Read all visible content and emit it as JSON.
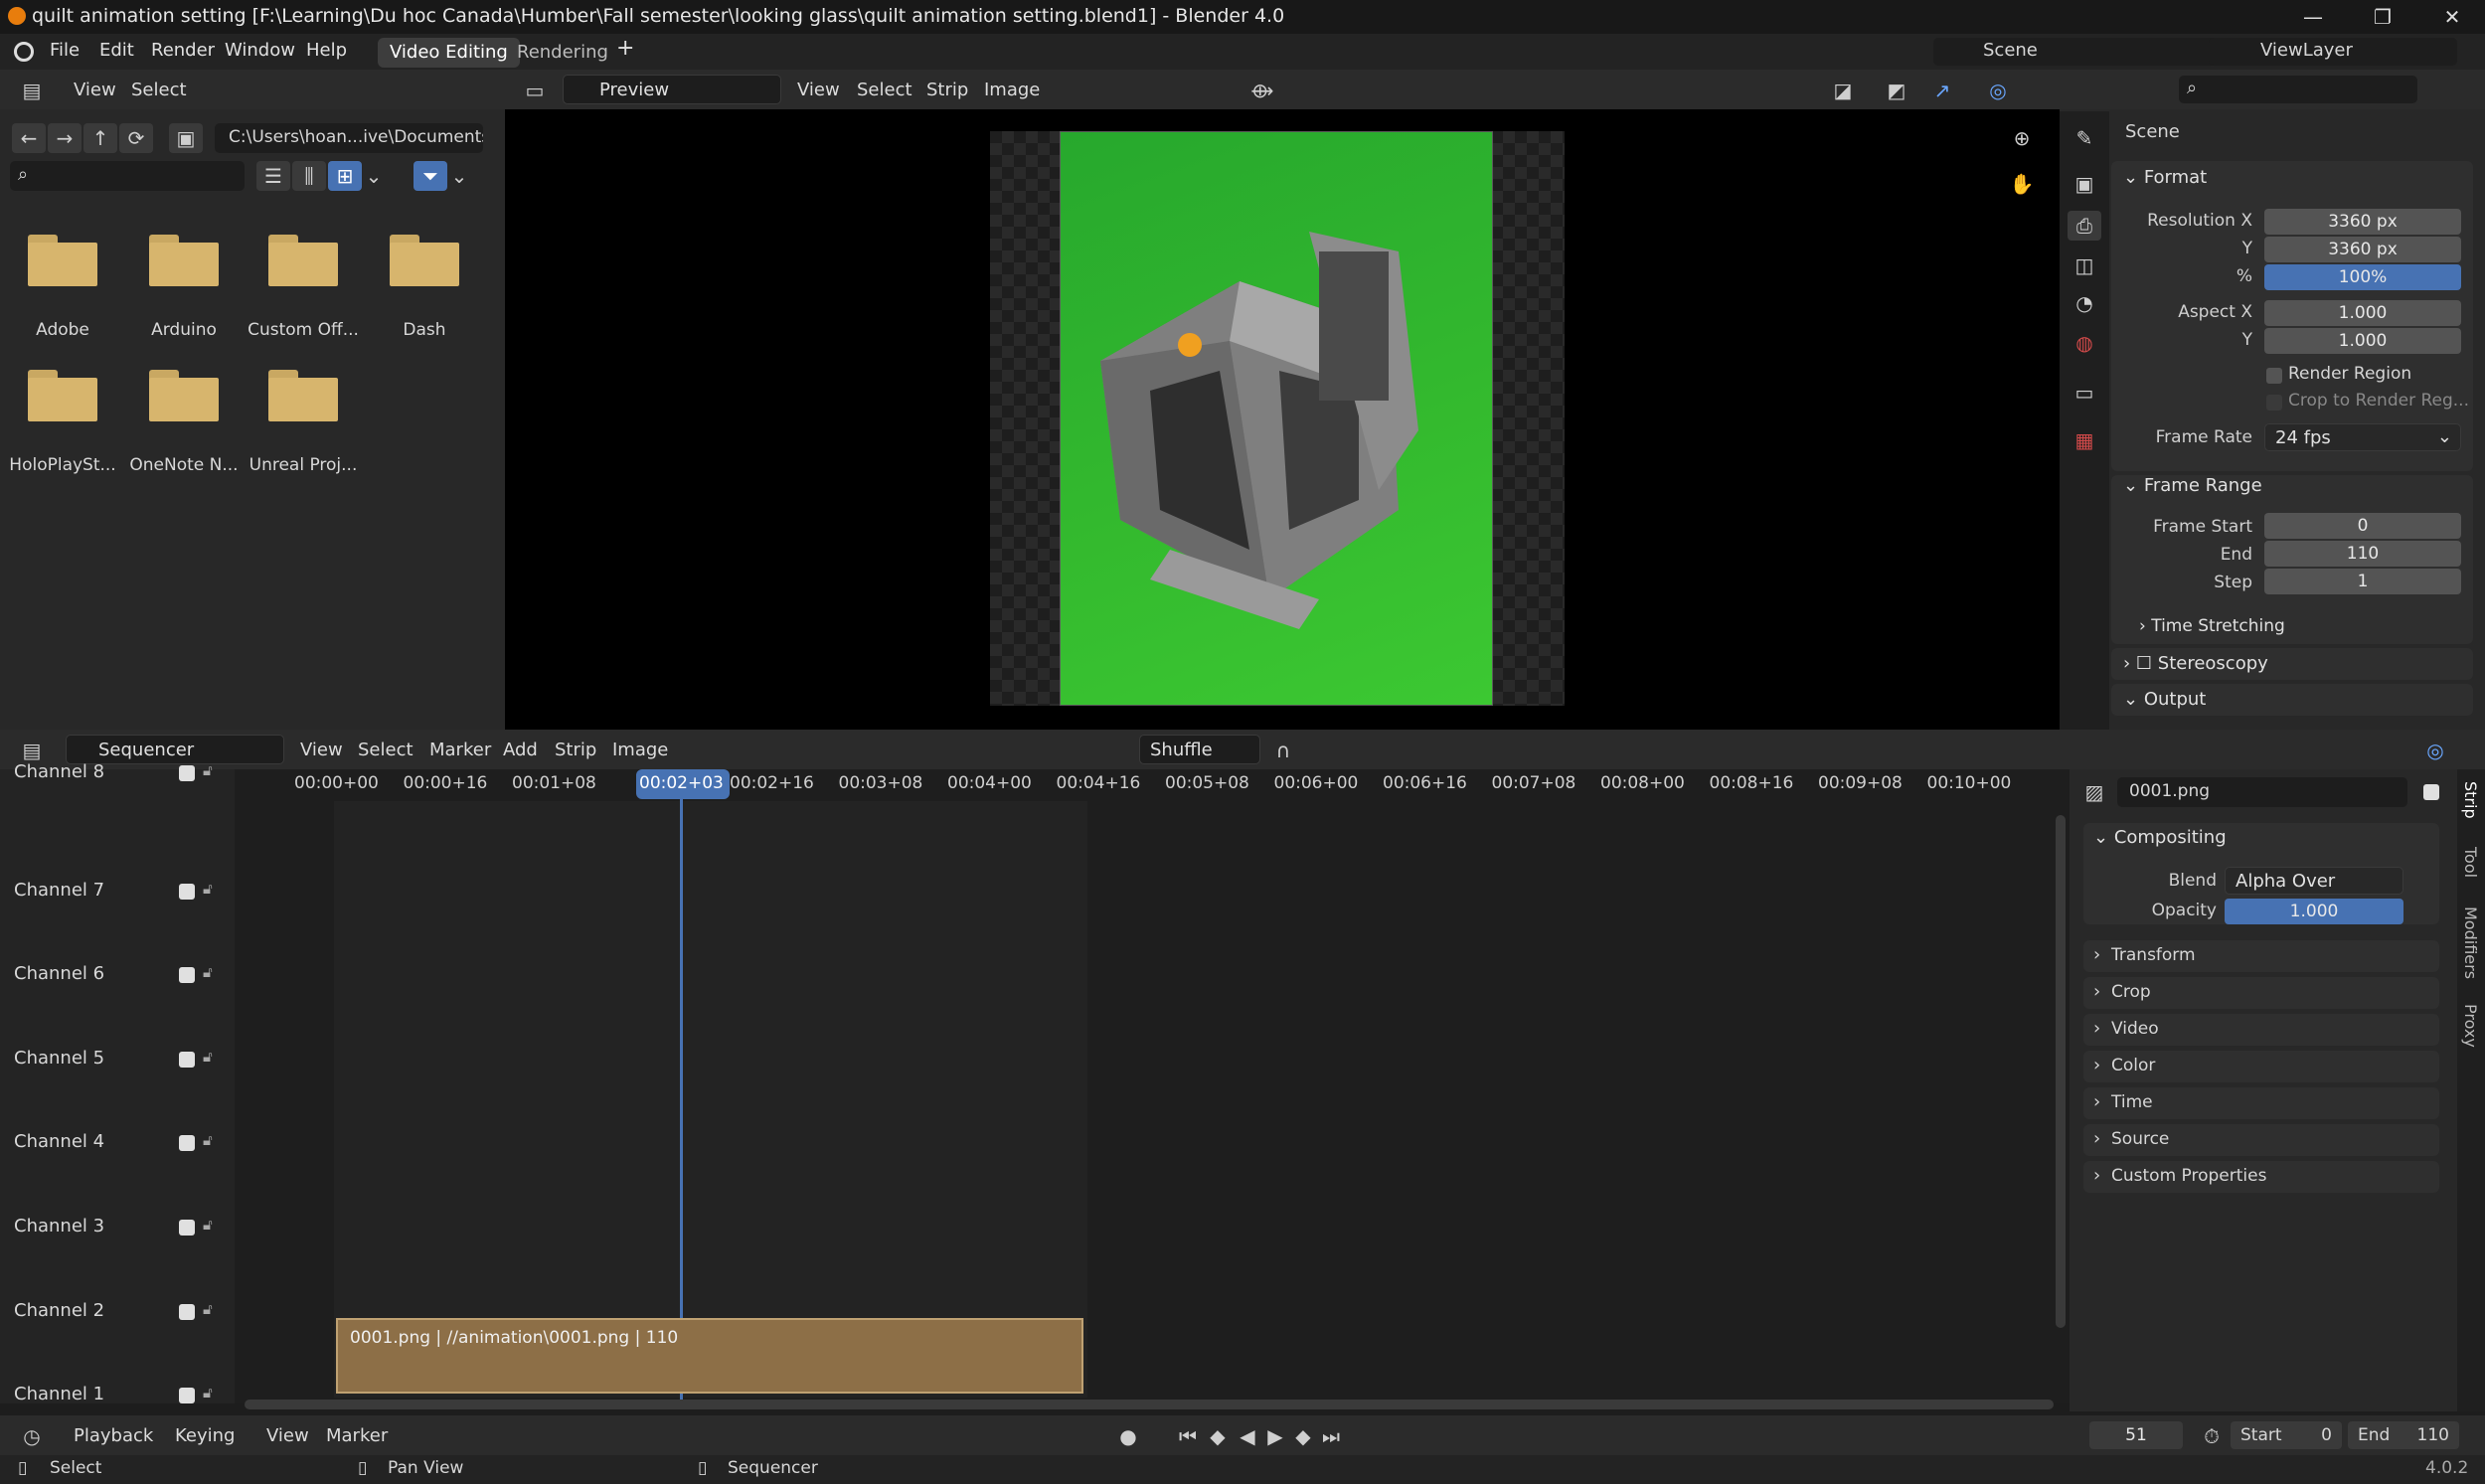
{
  "window": {
    "title": "quilt animation setting [F:\\Learning\\Du hoc Canada\\Humber\\Fall semester\\looking glass\\quilt animation setting.blend1] - Blender 4.0",
    "controls": [
      "—",
      "❐",
      "✕"
    ]
  },
  "menubar": {
    "items": [
      "File",
      "Edit",
      "Render",
      "Window",
      "Help"
    ],
    "workspaces": [
      "Video Editing",
      "Rendering"
    ],
    "add": "+",
    "scene": "Scene",
    "view_layer": "ViewLayer"
  },
  "file_browser": {
    "menu": [
      "View",
      "Select"
    ],
    "path": "C:\\Users\\hoan...ive\\Documents\\",
    "folders": [
      "Adobe",
      "Arduino",
      "Custom Off...",
      "Dash",
      "HoloPlaySt...",
      "OneNote N...",
      "Unreal Proj..."
    ]
  },
  "preview": {
    "mode": "Preview",
    "menu": [
      "View",
      "Select",
      "Strip",
      "Image"
    ]
  },
  "properties": {
    "scene_label": "Scene",
    "format": {
      "title": "Format",
      "res_x_label": "Resolution X",
      "res_x": "3360 px",
      "res_y_label": "Y",
      "res_y": "3360 px",
      "pct_label": "%",
      "pct": "100%",
      "aspect_x_label": "Aspect X",
      "aspect_x": "1.000",
      "aspect_y_label": "Y",
      "aspect_y": "1.000",
      "render_region": "Render Region",
      "crop": "Crop to Render Reg...",
      "fps_label": "Frame Rate",
      "fps": "24 fps"
    },
    "frame_range": {
      "title": "Frame Range",
      "start_label": "Frame Start",
      "start": "0",
      "end_label": "End",
      "end": "110",
      "step_label": "Step",
      "step": "1",
      "time_stretching": "Time Stretching"
    },
    "stereoscopy": "Stereoscopy",
    "output": "Output"
  },
  "sequencer": {
    "editor": "Sequencer",
    "menu": [
      "View",
      "Select",
      "Marker",
      "Add",
      "Strip",
      "Image"
    ],
    "shuffle": "Shuffle",
    "timecodes": [
      "00:00+00",
      "00:00+16",
      "00:01+08",
      "00:02+03",
      "00:02+16",
      "00:03+08",
      "00:04+00",
      "00:04+16",
      "00:05+08",
      "00:06+00",
      "00:06+16",
      "00:07+08",
      "00:08+00",
      "00:08+16",
      "00:09+08",
      "00:10+00"
    ],
    "current": "00:02+03",
    "channels": [
      "Channel 8",
      "Channel 7",
      "Channel 6",
      "Channel 5",
      "Channel 4",
      "Channel 3",
      "Channel 2",
      "Channel 1"
    ],
    "strip": "0001.png | //animation\\0001.png | 110"
  },
  "strip_panel": {
    "name": "0001.png",
    "compositing": "Compositing",
    "blend_label": "Blend",
    "blend": "Alpha Over",
    "opacity_label": "Opacity",
    "opacity": "1.000",
    "sections": [
      "Transform",
      "Crop",
      "Video",
      "Color",
      "Time",
      "Source",
      "Custom Properties"
    ],
    "side_tabs": [
      "Strip",
      "Tool",
      "Modifiers",
      "Proxy"
    ]
  },
  "timeline": {
    "playback": "Playback",
    "keying": "Keying",
    "view": "View",
    "marker": "Marker",
    "frame": "51",
    "start_label": "Start",
    "start": "0",
    "end_label": "End",
    "end": "110"
  },
  "status": {
    "select": "Select",
    "pan": "Pan View",
    "sequencer": "Sequencer",
    "version": "4.0.2"
  }
}
